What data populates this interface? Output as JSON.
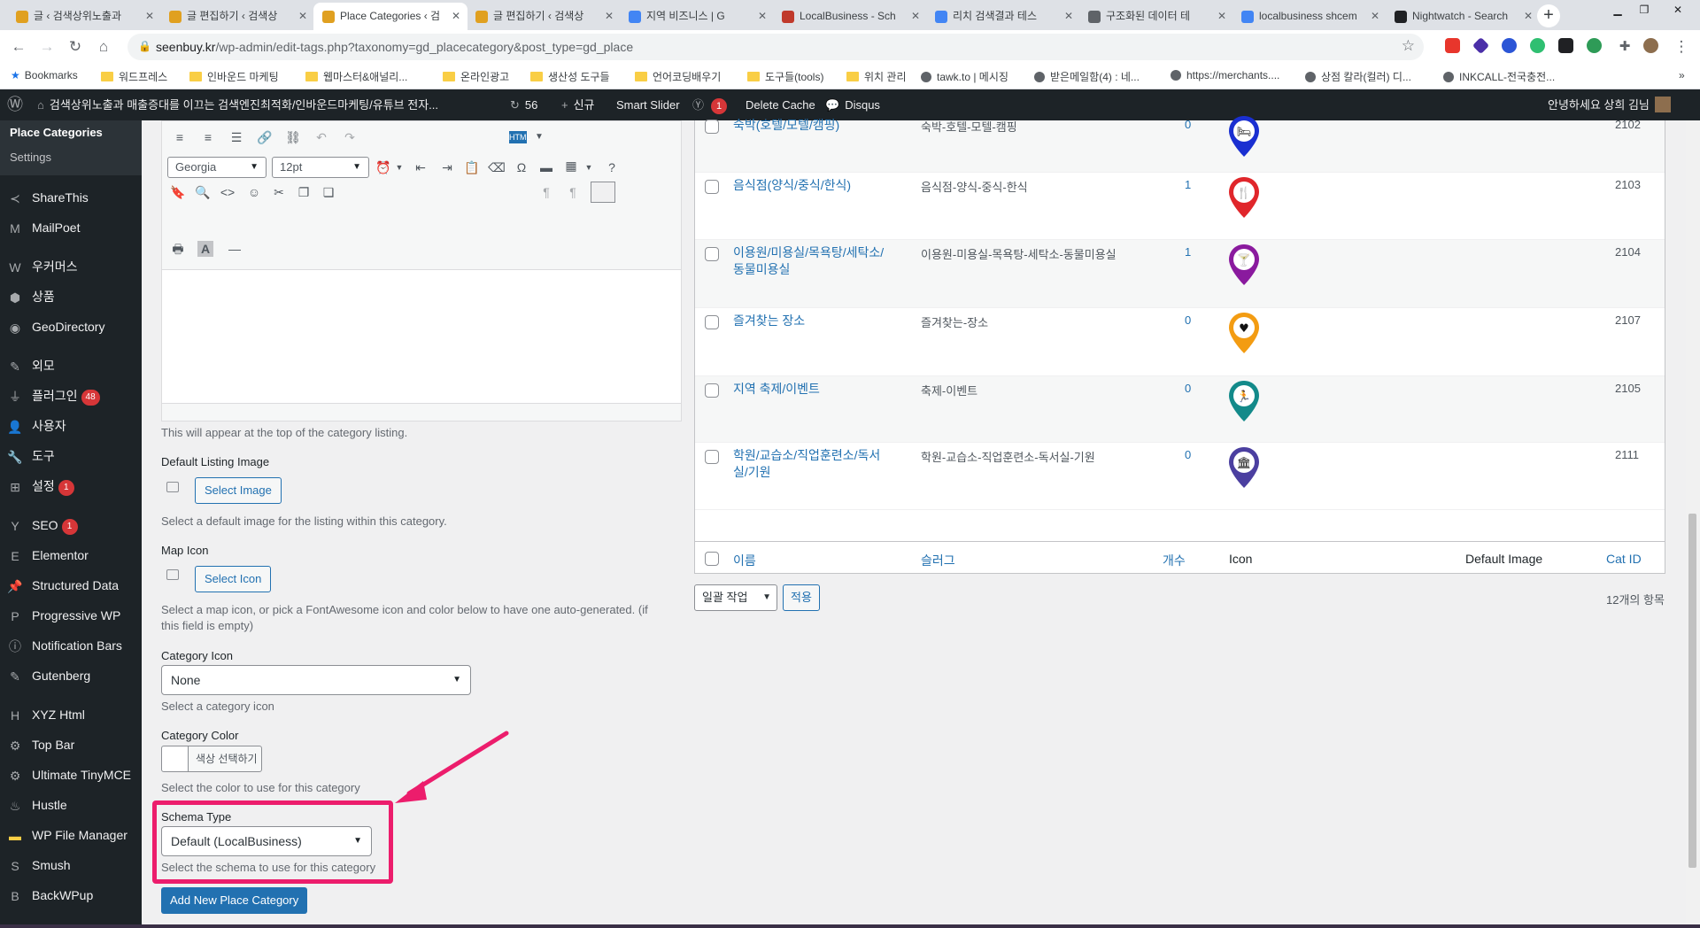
{
  "browser": {
    "tabs": [
      {
        "title": "글 ‹ 검색상위노출과",
        "color": "#e0a020"
      },
      {
        "title": "글 편집하기 ‹ 검색상",
        "color": "#e0a020"
      },
      {
        "title": "Place Categories ‹ 검",
        "color": "#e0a020"
      },
      {
        "title": "글 편집하기 ‹ 검색상",
        "color": "#e0a020"
      },
      {
        "title": "지역 비즈니스 | G",
        "color": "#4285f4"
      },
      {
        "title": "LocalBusiness - Sch",
        "color": "#c0392b"
      },
      {
        "title": "리치 검색결과 테스",
        "color": "#4285f4"
      },
      {
        "title": "구조화된 데이터 테",
        "color": "#5f6368"
      },
      {
        "title": "localbusiness shcem",
        "color": "#4285f4"
      },
      {
        "title": "Nightwatch - Search",
        "color": "#202124"
      }
    ],
    "new_tab": "+",
    "url_host": "seenbuy.kr",
    "url_path": "/wp-admin/edit-tags.php?taxonomy=gd_placecategory&post_type=gd_place",
    "bookmarks": [
      {
        "label": "Bookmarks",
        "type": "star"
      },
      {
        "label": "워드프레스",
        "type": "folder"
      },
      {
        "label": "인바운드 마케팅",
        "type": "folder"
      },
      {
        "label": "웹마스터&애널리...",
        "type": "folder"
      },
      {
        "label": "온라인광고",
        "type": "folder"
      },
      {
        "label": "생산성 도구들",
        "type": "folder"
      },
      {
        "label": "언어코딩배우기",
        "type": "folder"
      },
      {
        "label": "도구들(tools)",
        "type": "folder"
      },
      {
        "label": "위치 관리",
        "type": "folder"
      },
      {
        "label": "tawk.to | 메시징",
        "type": "link"
      },
      {
        "label": "받은메일함(4) : 네...",
        "type": "link"
      },
      {
        "label": "https://merchants....",
        "type": "link"
      },
      {
        "label": "상점 칼라(컬러) 디...",
        "type": "link"
      },
      {
        "label": "INKCALL-전국충전...",
        "type": "link"
      }
    ],
    "bookmarks_more": "»"
  },
  "adminbar": {
    "site_title": "검색상위노출과 매출증대를 이끄는 검색엔진최적화/인바운드마케팅/유튜브 전자...",
    "updates": "56",
    "new_label": "신규",
    "smart_slider": "Smart Slider",
    "yoast_count": "1",
    "delete_cache": "Delete Cache",
    "disqus": "Disqus",
    "greeting": "안녕하세요 상희 김님"
  },
  "sidebar": {
    "submenu": [
      {
        "label": "Place Categories"
      },
      {
        "label": "Settings"
      }
    ],
    "items": [
      {
        "label": "ShareThis",
        "icon": "share-icon",
        "badge": ""
      },
      {
        "label": "MailPoet",
        "icon": "mailpoet-icon",
        "badge": ""
      },
      {
        "label": "우커머스",
        "icon": "woo-icon",
        "badge": ""
      },
      {
        "label": "상품",
        "icon": "cube-icon",
        "badge": ""
      },
      {
        "label": "GeoDirectory",
        "icon": "globe-icon",
        "badge": ""
      },
      {
        "label": "외모",
        "icon": "brush-icon",
        "badge": ""
      },
      {
        "label": "플러그인",
        "icon": "plug-icon",
        "badge": "48"
      },
      {
        "label": "사용자",
        "icon": "user-icon",
        "badge": ""
      },
      {
        "label": "도구",
        "icon": "wrench-icon",
        "badge": ""
      },
      {
        "label": "설정",
        "icon": "settings-icon",
        "badge": "1"
      },
      {
        "label": "SEO",
        "icon": "yoast-icon",
        "badge": "1"
      },
      {
        "label": "Elementor",
        "icon": "elementor-icon",
        "badge": ""
      },
      {
        "label": "Structured Data",
        "icon": "pin-icon",
        "badge": ""
      },
      {
        "label": "Progressive WP",
        "icon": "pwa-icon",
        "badge": ""
      },
      {
        "label": "Notification Bars",
        "icon": "info-icon",
        "badge": ""
      },
      {
        "label": "Gutenberg",
        "icon": "pencil-icon",
        "badge": ""
      },
      {
        "label": "XYZ Html",
        "icon": "html-icon",
        "badge": ""
      },
      {
        "label": "Top Bar",
        "icon": "gear-icon",
        "badge": ""
      },
      {
        "label": "Ultimate TinyMCE",
        "icon": "gear-icon",
        "badge": ""
      },
      {
        "label": "Hustle",
        "icon": "hustle-icon",
        "badge": ""
      },
      {
        "label": "WP File Manager",
        "icon": "folder-icon",
        "badge": ""
      },
      {
        "label": "Smush",
        "icon": "smush-icon",
        "badge": ""
      },
      {
        "label": "BackWPup",
        "icon": "backup-icon",
        "badge": ""
      }
    ]
  },
  "form": {
    "font_family": "Georgia",
    "font_size": "12pt",
    "top_desc": "This will appear at the top of the category listing.",
    "default_image_label": "Default Listing Image",
    "select_image": "Select Image",
    "default_image_desc": "Select a default image for the listing within this category.",
    "map_icon_label": "Map Icon",
    "select_icon": "Select Icon",
    "map_icon_desc_1": "Select a map icon, or pick a FontAwesome icon and color below to have one auto-generated. (if",
    "map_icon_desc_2": "this field is empty)",
    "category_icon_label": "Category Icon",
    "category_icon_value": "None",
    "category_icon_desc": "Select a category icon",
    "category_color_label": "Category Color",
    "color_button": "색상 선택하기",
    "category_color_desc": "Select the color to use for this category",
    "schema_label": "Schema Type",
    "schema_value": "Default (LocalBusiness)",
    "schema_desc": "Select the schema to use for this category",
    "add_button": "Add New Place Category"
  },
  "table": {
    "rows": [
      {
        "name_1": "숙박(호텔/모텔/캠핑)",
        "name_2": "",
        "slug": "숙박-호텔-모텔-캠핑",
        "count": "0",
        "id": "2102",
        "pin_color": "#1a2fd1",
        "glyph": "🛏"
      },
      {
        "name_1": "음식점(양식/중식/한식)",
        "name_2": "",
        "slug": "음식점-양식-중식-한식",
        "count": "1",
        "id": "2103",
        "pin_color": "#e0262b",
        "glyph": "🍴"
      },
      {
        "name_1": "이용원/미용실/목욕탕/세탁소/",
        "name_2": "동물미용실",
        "slug": "이용원-미용실-목욕탕-세탁소-동물미용실",
        "count": "1",
        "id": "2104",
        "pin_color": "#8a1a9e",
        "glyph": "🍸"
      },
      {
        "name_1": "즐겨찾는 장소",
        "name_2": "",
        "slug": "즐겨찾는-장소",
        "count": "0",
        "id": "2107",
        "pin_color": "#f39c12",
        "glyph": "♥"
      },
      {
        "name_1": "지역 축제/이벤트",
        "name_2": "",
        "slug": "축제-이벤트",
        "count": "0",
        "id": "2105",
        "pin_color": "#138a8a",
        "glyph": "🏃"
      },
      {
        "name_1": "학원/교습소/직업훈련소/독서",
        "name_2": "실/기원",
        "slug": "학원-교습소-직업훈련소-독서실-기원",
        "count": "0",
        "id": "2111",
        "pin_color": "#4b3fa0",
        "glyph": "🏛"
      }
    ],
    "footer_cols": {
      "name": "이름",
      "slug": "슬러그",
      "count": "개수",
      "icon": "Icon",
      "default_image": "Default Image",
      "cat_id": "Cat ID"
    },
    "bulk_action": "일괄 작업",
    "apply": "적용",
    "item_count": "12개의 항목"
  }
}
